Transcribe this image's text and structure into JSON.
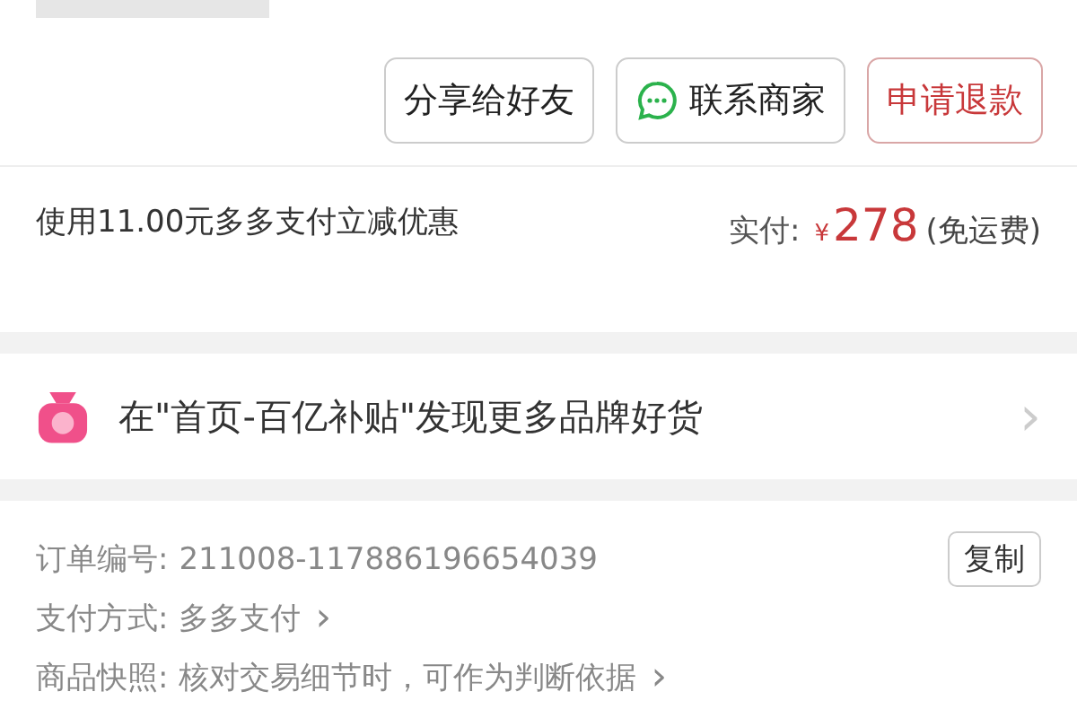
{
  "actions": [
    {
      "label": "分享给好友",
      "kind": "plain"
    },
    {
      "label": "联系商家",
      "kind": "chat"
    },
    {
      "label": "申请退款",
      "kind": "danger"
    }
  ],
  "payment": {
    "discount_note": "使用11.00元多多支付立减优惠",
    "paid_label": "实付:",
    "currency": "¥",
    "amount": "278",
    "shipping": "(免运费)"
  },
  "promo": {
    "text": "在\"首页-百亿补贴\"发现更多品牌好货",
    "chevron": "›"
  },
  "order_info": [
    {
      "label": "订单编号:",
      "value": "211008-117886196654039",
      "action": "复制"
    },
    {
      "label": "支付方式:",
      "value": "多多支付",
      "chevron": "›"
    },
    {
      "label": "商品快照:",
      "value": "核对交易细节时，可作为判断依据",
      "chevron": "›"
    }
  ]
}
